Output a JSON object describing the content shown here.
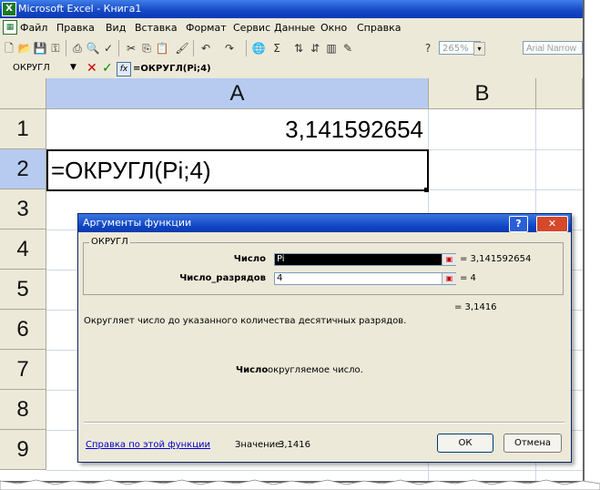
{
  "app": {
    "title": "Microsoft Excel - Книга1",
    "icon_text": "X"
  },
  "menu": {
    "items": [
      "Файл",
      "Правка",
      "Вид",
      "Вставка",
      "Формат",
      "Сервис",
      "Данные",
      "Окно",
      "Справка"
    ]
  },
  "toolbar": {
    "zoom": "265%",
    "font": "Arial Narrow",
    "icons": [
      "new-icon",
      "open-icon",
      "save-icon",
      "permission-icon",
      "print-icon",
      "print-preview-icon",
      "spelling-icon",
      "cut-icon",
      "copy-icon",
      "paste-icon",
      "format-painter-icon",
      "undo-icon",
      "redo-icon",
      "hyperlink-icon",
      "autosum-icon",
      "sort-asc-icon",
      "sort-desc-icon",
      "chart-wizard-icon",
      "drawing-icon",
      "help-icon"
    ]
  },
  "formula_bar": {
    "name_box": "ОКРУГЛ",
    "formula": "=ОКРУГЛ(Pi;4)",
    "fx_label": "fx"
  },
  "sheet": {
    "columns": [
      "A",
      "B"
    ],
    "rows": [
      "1",
      "2",
      "3",
      "4",
      "5",
      "6",
      "7",
      "8",
      "9"
    ],
    "cells": {
      "A1": "3,141592654",
      "A2": "=ОКРУГЛ(Pi;4)"
    }
  },
  "dialog": {
    "title": "Аргументы функции",
    "group_label": "ОКРУГЛ",
    "args": [
      {
        "label": "Число",
        "value": "Pi",
        "result": "= 3,141592654"
      },
      {
        "label": "Число_разрядов",
        "value": "4",
        "result": "= 4"
      }
    ],
    "result": "= 3,1416",
    "description": "Округляет число до указанного количества десятичных разрядов.",
    "arg_help_label": "Число",
    "arg_help_text": "округляемое число.",
    "help_link": "Справка по этой функции",
    "value_label": "Значение:",
    "value": "3,1416",
    "ok_label": "ОК",
    "cancel_label": "Отмена"
  },
  "colors": {
    "titlebar": "#1546c4",
    "selected_header": "#b6cbef",
    "close_button": "#d5482a"
  }
}
